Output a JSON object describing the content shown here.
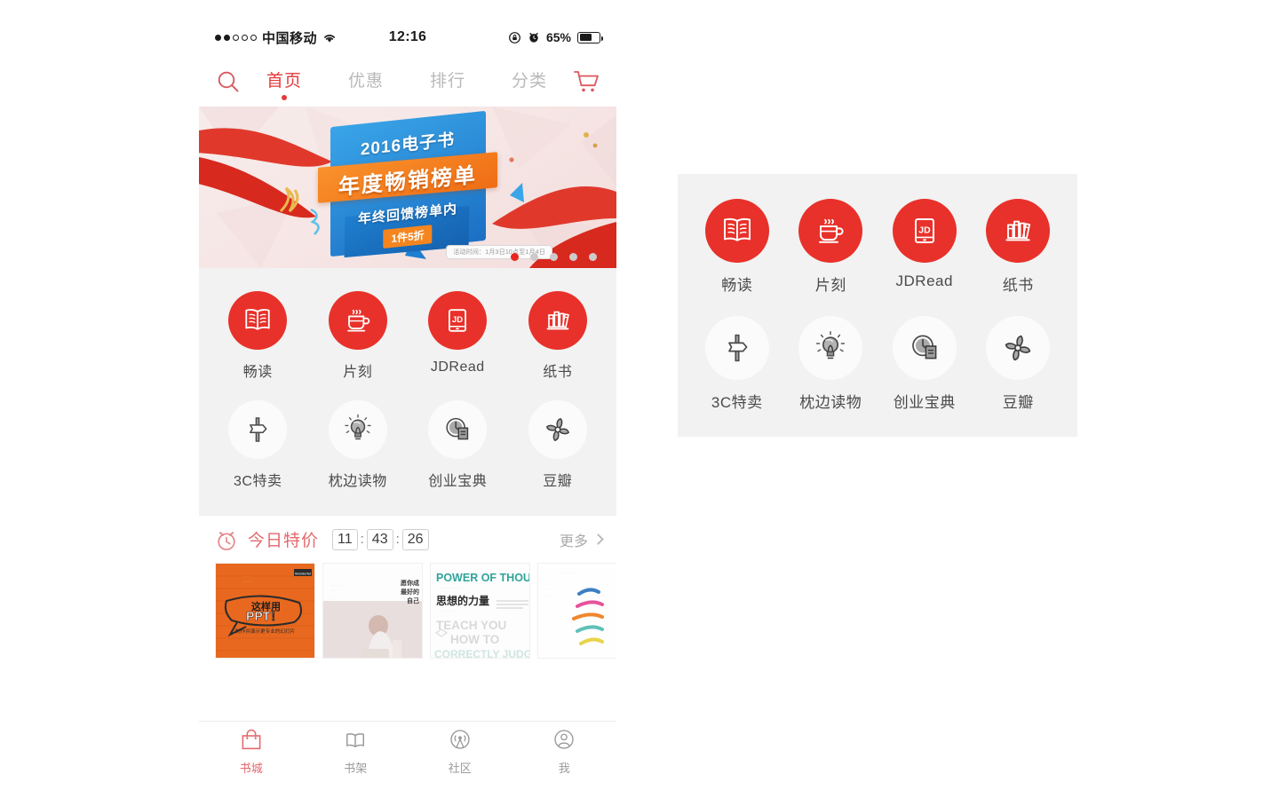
{
  "colors": {
    "brand_red": "#e8312a",
    "nav_active": "#e4393c",
    "tab_active": "#e4686b",
    "icon_gray": "#555555",
    "label_gray": "#4a4a4a",
    "panel_bg": "#f2f2f2"
  },
  "status_bar": {
    "signal_dots_filled": 2,
    "signal_dots_total": 5,
    "carrier": "中国移动",
    "wifi_icon": "wifi-icon",
    "time": "12:16",
    "rotation_lock_icon": "rotation-lock-icon",
    "alarm_icon": "alarm-icon",
    "battery_percent": "65%",
    "battery_level": 65
  },
  "top_nav": {
    "search_icon": "search-icon",
    "cart_icon": "shopping-cart-icon",
    "tabs": [
      {
        "label": "首页",
        "active": true
      },
      {
        "label": "优惠",
        "active": false
      },
      {
        "label": "排行",
        "active": false
      },
      {
        "label": "分类",
        "active": false
      }
    ]
  },
  "banner": {
    "line1": "2016电子书",
    "line2": "年度畅销榜单",
    "line3": "年终回馈榜单内",
    "badge": "1件5折",
    "note": "活动时间：1月3日10点至1月4日",
    "dots_total": 5,
    "dot_active_index": 0
  },
  "icon_grid": {
    "items": [
      {
        "label": "畅读",
        "icon": "open-book-icon",
        "style": "red"
      },
      {
        "label": "片刻",
        "icon": "coffee-cup-icon",
        "style": "red"
      },
      {
        "label": "JDRead",
        "icon": "tablet-jd-icon",
        "style": "red"
      },
      {
        "label": "纸书",
        "icon": "bookshelf-icon",
        "style": "red"
      },
      {
        "label": "3C特卖",
        "icon": "signpost-icon",
        "style": "white"
      },
      {
        "label": "枕边读物",
        "icon": "lightbulb-icon",
        "style": "white"
      },
      {
        "label": "创业宝典",
        "icon": "clock-document-icon",
        "style": "white"
      },
      {
        "label": "豆瓣",
        "icon": "pinwheel-icon",
        "style": "white"
      }
    ]
  },
  "deals": {
    "alarm_icon": "alarm-clock-icon",
    "title": "今日特价",
    "hours": "11",
    "minutes": "43",
    "seconds": "26",
    "sep": ":",
    "more_label": "更多",
    "chevron_icon": "chevron-right-icon",
    "books": [
      {
        "title_main": "这样用",
        "title_big": "PPT！",
        "subtitle": "制作并演示更专业的幻灯片",
        "brand": "Wonderful",
        "cover_style": "orange-ppt"
      },
      {
        "title_main": "愿你成为",
        "subtitle": "最好的自己",
        "cover_style": "light-photo"
      },
      {
        "title_main": "POWER OF THOUGHT",
        "title_cn": "思想的力量",
        "subtitle": "TEACH YOU HOW TO CORRECTLY JUDGE",
        "cover_style": "teal-thought"
      },
      {
        "title_main": "",
        "cover_style": "colorful-brushes"
      }
    ]
  },
  "tab_bar": {
    "items": [
      {
        "label": "书城",
        "icon": "shopping-bag-icon",
        "active": true
      },
      {
        "label": "书架",
        "icon": "open-book-icon",
        "active": false
      },
      {
        "label": "社区",
        "icon": "broadcast-icon",
        "active": false
      },
      {
        "label": "我",
        "icon": "person-icon",
        "active": false
      }
    ]
  },
  "callout": {
    "items": [
      {
        "label": "畅读",
        "icon": "open-book-icon",
        "style": "red"
      },
      {
        "label": "片刻",
        "icon": "coffee-cup-icon",
        "style": "red"
      },
      {
        "label": "JDRead",
        "icon": "tablet-jd-icon",
        "style": "red"
      },
      {
        "label": "纸书",
        "icon": "bookshelf-icon",
        "style": "red"
      },
      {
        "label": "3C特卖",
        "icon": "signpost-icon",
        "style": "white"
      },
      {
        "label": "枕边读物",
        "icon": "lightbulb-icon",
        "style": "white"
      },
      {
        "label": "创业宝典",
        "icon": "clock-document-icon",
        "style": "white"
      },
      {
        "label": "豆瓣",
        "icon": "pinwheel-icon",
        "style": "white"
      }
    ]
  }
}
